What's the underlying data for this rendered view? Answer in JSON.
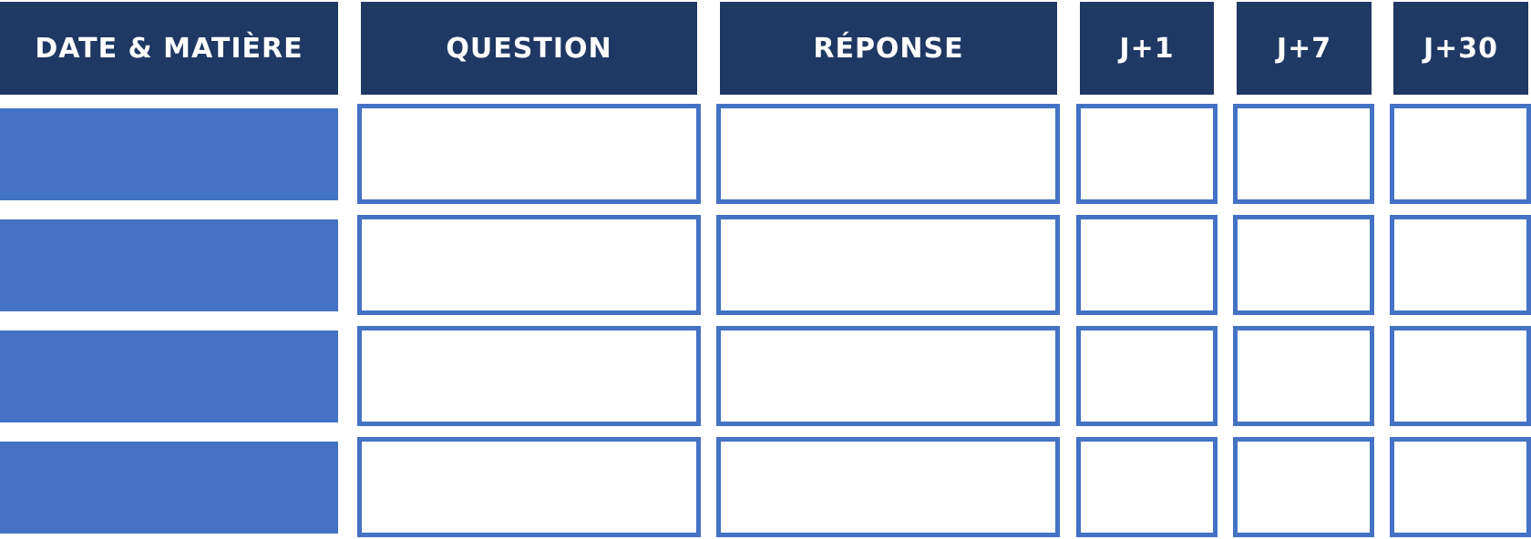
{
  "table": {
    "headers": [
      "DATE & MATIÈRE",
      "QUESTION",
      "RÉPONSE",
      "J+1",
      "J+7",
      "J+30"
    ],
    "rows": [
      [
        "",
        "",
        "",
        "",
        "",
        ""
      ],
      [
        "",
        "",
        "",
        "",
        "",
        ""
      ],
      [
        "",
        "",
        "",
        "",
        "",
        ""
      ],
      [
        "",
        "",
        "",
        "",
        "",
        ""
      ]
    ]
  },
  "colors": {
    "header_bg": "#1f3864",
    "header_text": "#ffffff",
    "first_column_fill": "#4472c4",
    "cell_border": "#4472c4",
    "cell_bg": "#ffffff"
  }
}
